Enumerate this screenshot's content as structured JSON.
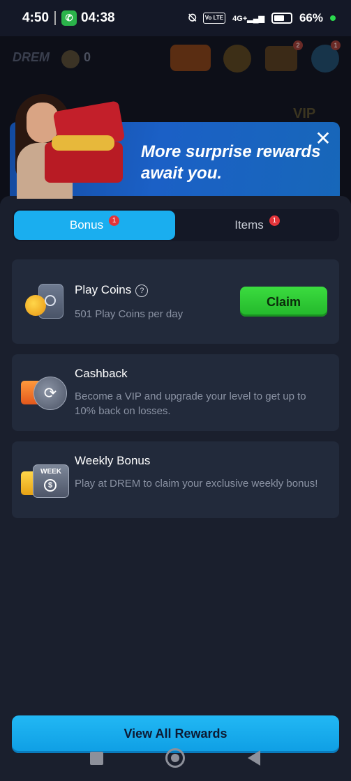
{
  "status_bar": {
    "time": "4:50",
    "call_timer": "04:38",
    "network_badge": "Vo LTE",
    "signal_label": "4G+",
    "battery": "66%",
    "battery_level": 0.66
  },
  "background_app": {
    "logo": "DREM",
    "balance": "0",
    "chest_badge": "2",
    "ball_badge": "1",
    "vip_label": "VIP"
  },
  "banner": {
    "title": "More surprise rewards await you."
  },
  "tabs": [
    {
      "label": "Bonus",
      "badge": "1",
      "active": true
    },
    {
      "label": "Items",
      "badge": "1",
      "active": false
    }
  ],
  "cards": {
    "play_coins": {
      "title": "Play Coins",
      "description": "501 Play Coins per day",
      "button": "Claim"
    },
    "cashback": {
      "title": "Cashback",
      "description": "Become a VIP and upgrade your level to get up to 10% back on losses."
    },
    "weekly_bonus": {
      "title": "Weekly Bonus",
      "description": "Play at DREM to claim your exclusive weekly bonus!",
      "icon_label": "WEEK"
    }
  },
  "footer": {
    "view_all_label": "View All Rewards"
  },
  "colors": {
    "accent_blue": "#1aaeef",
    "claim_green": "#2fcc35",
    "badge_red": "#e3343a",
    "panel_bg": "#1a1f2d",
    "card_bg": "#222a3b"
  }
}
